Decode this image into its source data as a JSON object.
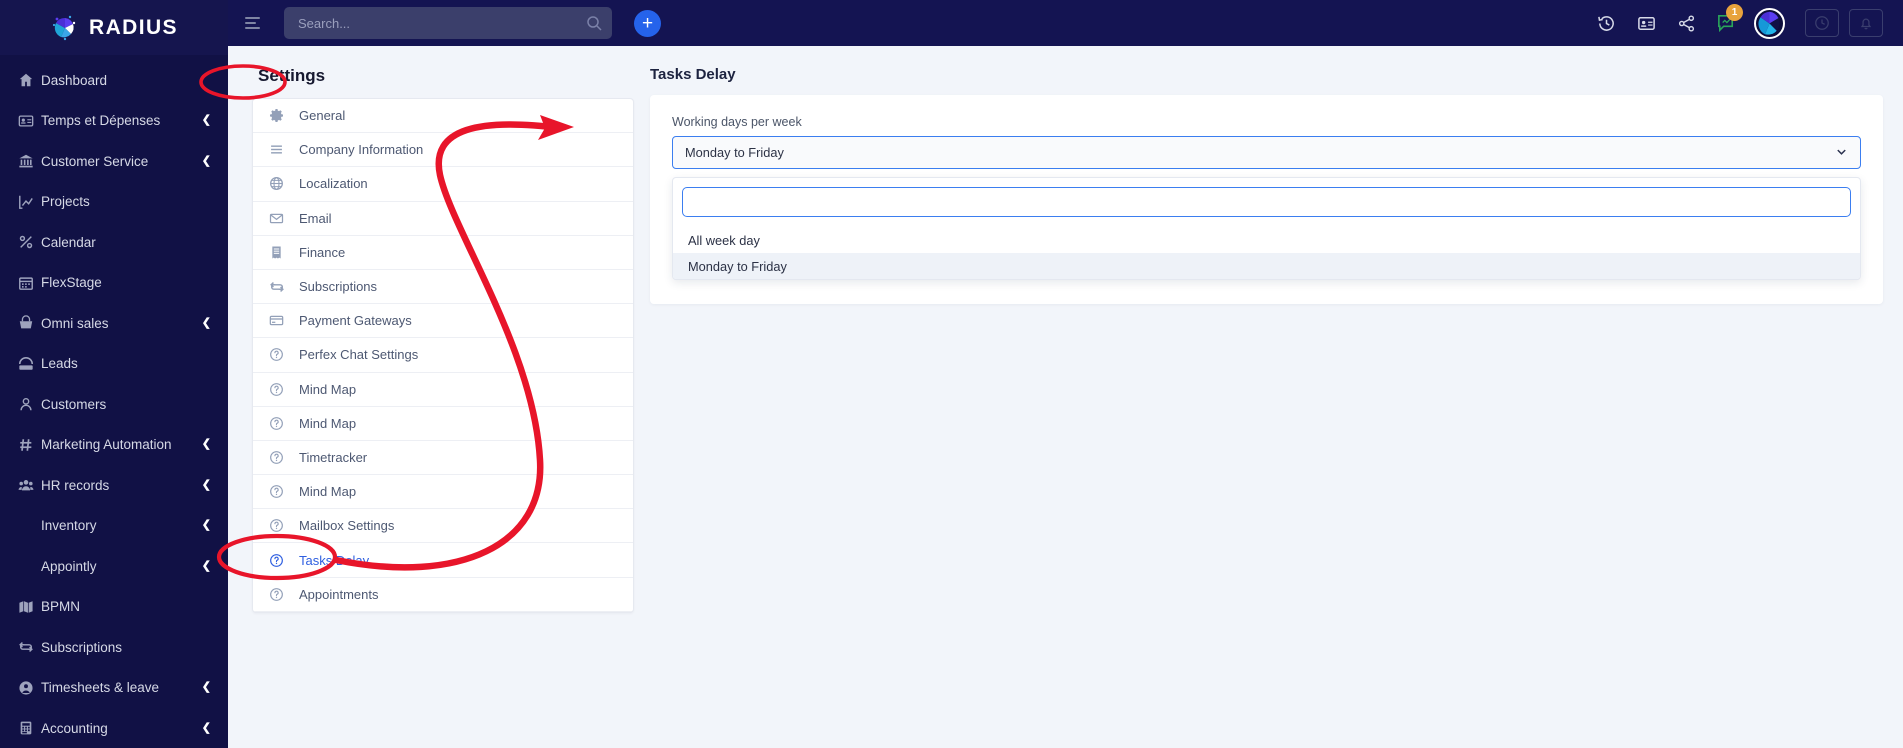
{
  "brand": {
    "name": "RADIUS",
    "logo_icon": "radius-pinwheel-logo"
  },
  "topbar": {
    "menu_toggle_icon": "hamburger-icon",
    "search": {
      "placeholder": "Search...",
      "value": "",
      "icon": "search-icon"
    },
    "add_button_label": "+",
    "icons": [
      {
        "name": "history-icon",
        "glyph": "history"
      },
      {
        "name": "contact-card-icon",
        "glyph": "id-card"
      },
      {
        "name": "share-icon",
        "glyph": "share"
      },
      {
        "name": "chat-icon",
        "glyph": "chat",
        "badge": "1"
      }
    ],
    "avatar_name": "user-avatar",
    "right_buttons": [
      {
        "name": "clock-icon"
      },
      {
        "name": "bell-icon"
      }
    ]
  },
  "sidebar": {
    "items": [
      {
        "label": "Dashboard",
        "icon": "home-icon",
        "caret": false
      },
      {
        "label": "Temps et Dépenses",
        "icon": "id-card-icon",
        "caret": true
      },
      {
        "label": "Customer Service",
        "icon": "bank-icon",
        "caret": true
      },
      {
        "label": "Projects",
        "icon": "chart-icon",
        "caret": false
      },
      {
        "label": "Calendar",
        "icon": "percent-icon",
        "caret": false
      },
      {
        "label": "FlexStage",
        "icon": "calendar-icon",
        "caret": false
      },
      {
        "label": "Omni sales",
        "icon": "basket-icon",
        "caret": true
      },
      {
        "label": "Leads",
        "icon": "phone-icon",
        "caret": false
      },
      {
        "label": "Customers",
        "icon": "user-icon",
        "caret": false
      },
      {
        "label": "Marketing Automation",
        "icon": "hash-icon",
        "caret": true
      },
      {
        "label": "HR records",
        "icon": "users-icon",
        "caret": true
      },
      {
        "label": "Inventory",
        "icon": "none",
        "caret": true
      },
      {
        "label": "Appointly",
        "icon": "none",
        "caret": true
      },
      {
        "label": "BPMN",
        "icon": "map-icon",
        "caret": false
      },
      {
        "label": "Subscriptions",
        "icon": "refresh-icon",
        "caret": false
      },
      {
        "label": "Timesheets & leave",
        "icon": "user-circle-icon",
        "caret": true
      },
      {
        "label": "Accounting",
        "icon": "calculator-icon",
        "caret": true
      }
    ]
  },
  "settings_panel": {
    "title": "Settings",
    "items": [
      {
        "label": "General",
        "icon": "gear-icon",
        "active": false
      },
      {
        "label": "Company Information",
        "icon": "lines-icon",
        "active": false
      },
      {
        "label": "Localization",
        "icon": "globe-icon",
        "active": false
      },
      {
        "label": "Email",
        "icon": "envelope-icon",
        "active": false
      },
      {
        "label": "Finance",
        "icon": "receipt-icon",
        "active": false
      },
      {
        "label": "Subscriptions",
        "icon": "refresh-icon",
        "active": false
      },
      {
        "label": "Payment Gateways",
        "icon": "credit-card-icon",
        "active": false
      },
      {
        "label": "Perfex Chat Settings",
        "icon": "question-icon",
        "active": false
      },
      {
        "label": "Mind Map",
        "icon": "question-icon",
        "active": false
      },
      {
        "label": "Mind Map",
        "icon": "question-icon",
        "active": false
      },
      {
        "label": "Timetracker",
        "icon": "question-icon",
        "active": false
      },
      {
        "label": "Mind Map",
        "icon": "question-icon",
        "active": false
      },
      {
        "label": "Mailbox Settings",
        "icon": "question-icon",
        "active": false
      },
      {
        "label": "Tasks Delay",
        "icon": "question-icon",
        "active": true
      },
      {
        "label": "Appointments",
        "icon": "question-icon",
        "active": false
      }
    ]
  },
  "main": {
    "title": "Tasks Delay",
    "field": {
      "label": "Working days per week",
      "selected": "Monday to Friday",
      "chevron_icon": "chevron-down-icon"
    },
    "dropdown": {
      "search_value": "",
      "search_placeholder": "",
      "options": [
        {
          "label": "All week day",
          "selected": false
        },
        {
          "label": "Monday to Friday",
          "selected": true
        }
      ]
    }
  },
  "colors": {
    "sidebar_bg": "#111145",
    "topbar_bg": "#141452",
    "accent_blue": "#2f5fe0",
    "focus_blue": "#3b7ef0",
    "annotation_red": "#e8152a",
    "badge_orange": "#e8a33d",
    "page_bg": "#f2f5fa"
  }
}
